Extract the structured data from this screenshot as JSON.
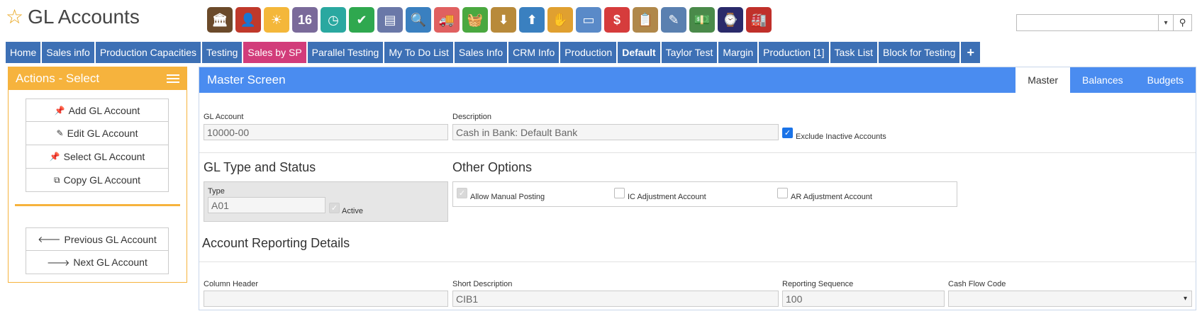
{
  "app": {
    "title": "GL Accounts"
  },
  "toolbar_icons": [
    {
      "name": "bank-icon",
      "color": "#6b4a2a",
      "glyph": "🏛"
    },
    {
      "name": "user-icon",
      "color": "#c0392b",
      "glyph": "👤"
    },
    {
      "name": "weather-icon",
      "color": "#f4b73a",
      "glyph": "☀"
    },
    {
      "name": "calendar-icon",
      "color": "#7a6a9a",
      "glyph": "16"
    },
    {
      "name": "clock-icon",
      "color": "#2aa8a0",
      "glyph": "◷"
    },
    {
      "name": "checkmark-icon",
      "color": "#2fa84f",
      "glyph": "✔"
    },
    {
      "name": "register-icon",
      "color": "#6a78a8",
      "glyph": "▤"
    },
    {
      "name": "magnifier-icon",
      "color": "#3a80c0",
      "glyph": "🔍"
    },
    {
      "name": "truck-icon",
      "color": "#e06060",
      "glyph": "🚚"
    },
    {
      "name": "basket-icon",
      "color": "#4aa840",
      "glyph": "🧺"
    },
    {
      "name": "inbox-download-icon",
      "color": "#b88a3a",
      "glyph": "⬇"
    },
    {
      "name": "outbox-upload-icon",
      "color": "#3a80c0",
      "glyph": "⬆"
    },
    {
      "name": "hand-coins-icon",
      "color": "#e0a030",
      "glyph": "✋"
    },
    {
      "name": "monitor-icon",
      "color": "#5a8ac8",
      "glyph": "▭"
    },
    {
      "name": "money-bubble-icon",
      "color": "#d63c3c",
      "glyph": "$"
    },
    {
      "name": "clipboard-icon",
      "color": "#b0884a",
      "glyph": "📋"
    },
    {
      "name": "pencil-paper-icon",
      "color": "#5a80b0",
      "glyph": "✎"
    },
    {
      "name": "cash-icon",
      "color": "#4a8a4a",
      "glyph": "💵"
    },
    {
      "name": "device-icon",
      "color": "#2a2a6a",
      "glyph": "⌚"
    },
    {
      "name": "factory-icon",
      "color": "#c0302a",
      "glyph": "🏭"
    }
  ],
  "search": {
    "value": "",
    "placeholder": ""
  },
  "tabs": [
    {
      "label": "Home"
    },
    {
      "label": "Sales info"
    },
    {
      "label": "Production Capacities"
    },
    {
      "label": "Testing"
    },
    {
      "label": "Sales by SP"
    },
    {
      "label": "Parallel Testing"
    },
    {
      "label": "My To Do List"
    },
    {
      "label": "Sales Info"
    },
    {
      "label": "CRM Info"
    },
    {
      "label": "Production"
    },
    {
      "label": "Default"
    },
    {
      "label": "Taylor Test"
    },
    {
      "label": "Margin"
    },
    {
      "label": "Production [1]"
    },
    {
      "label": "Task List"
    },
    {
      "label": "Block for Testing"
    },
    {
      "label": "+"
    }
  ],
  "actions_panel": {
    "title": "Actions - Select",
    "group1": [
      {
        "label": "Add GL Account"
      },
      {
        "label": "Edit GL Account"
      },
      {
        "label": "Select GL Account"
      },
      {
        "label": "Copy GL Account"
      }
    ],
    "group2": [
      {
        "label": "Previous GL Account"
      },
      {
        "label": "Next GL Account"
      }
    ]
  },
  "main": {
    "title": "Master Screen",
    "tabs": [
      {
        "label": "Master"
      },
      {
        "label": "Balances"
      },
      {
        "label": "Budgets"
      }
    ],
    "gl_account_label": "GL Account",
    "gl_account_value": "10000-00",
    "description_label": "Description",
    "description_value": "Cash in Bank: Default Bank",
    "exclude_inactive_label": "Exclude Inactive Accounts",
    "gl_type_section": "GL Type and Status",
    "type_label": "Type",
    "type_value": "A01",
    "active_label": "Active",
    "other_options_section": "Other Options",
    "allow_manual_posting_label": "Allow Manual Posting",
    "ic_adjustment_label": "IC Adjustment Account",
    "ar_adjustment_label": "AR Adjustment Account",
    "reporting_section": "Account Reporting Details",
    "column_header_label": "Column Header",
    "column_header_value": "",
    "short_description_label": "Short Description",
    "short_description_value": "CIB1",
    "reporting_sequence_label": "Reporting Sequence",
    "reporting_sequence_value": "100",
    "cash_flow_code_label": "Cash Flow Code",
    "cash_flow_code_value": ""
  }
}
